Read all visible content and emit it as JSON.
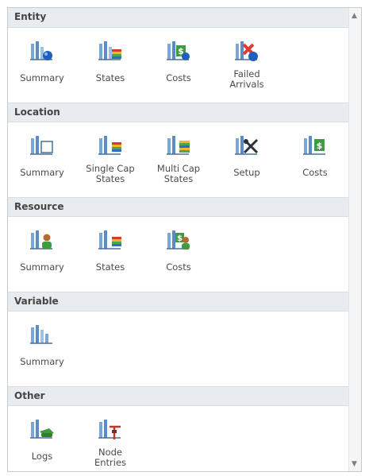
{
  "sections": [
    {
      "title": "Entity",
      "items": [
        {
          "label": "Summary",
          "icon": "summary-icon"
        },
        {
          "label": "States",
          "icon": "states-icon"
        },
        {
          "label": "Costs",
          "icon": "costs-icon"
        },
        {
          "label": "Failed\nArrivals",
          "icon": "failed-arrivals-icon"
        }
      ]
    },
    {
      "title": "Location",
      "items": [
        {
          "label": "Summary",
          "icon": "summary-icon"
        },
        {
          "label": "Single Cap\nStates",
          "icon": "single-cap-states-icon"
        },
        {
          "label": "Multi Cap\nStates",
          "icon": "multi-cap-states-icon"
        },
        {
          "label": "Setup",
          "icon": "setup-icon"
        },
        {
          "label": "Costs",
          "icon": "costs-icon"
        }
      ]
    },
    {
      "title": "Resource",
      "items": [
        {
          "label": "Summary",
          "icon": "resource-summary-icon"
        },
        {
          "label": "States",
          "icon": "states-icon"
        },
        {
          "label": "Costs",
          "icon": "resource-costs-icon"
        }
      ]
    },
    {
      "title": "Variable",
      "items": [
        {
          "label": "Summary",
          "icon": "summary-icon"
        }
      ]
    },
    {
      "title": "Other",
      "items": [
        {
          "label": "Logs",
          "icon": "logs-icon"
        },
        {
          "label": "Node\nEntries",
          "icon": "node-entries-icon"
        }
      ]
    }
  ]
}
